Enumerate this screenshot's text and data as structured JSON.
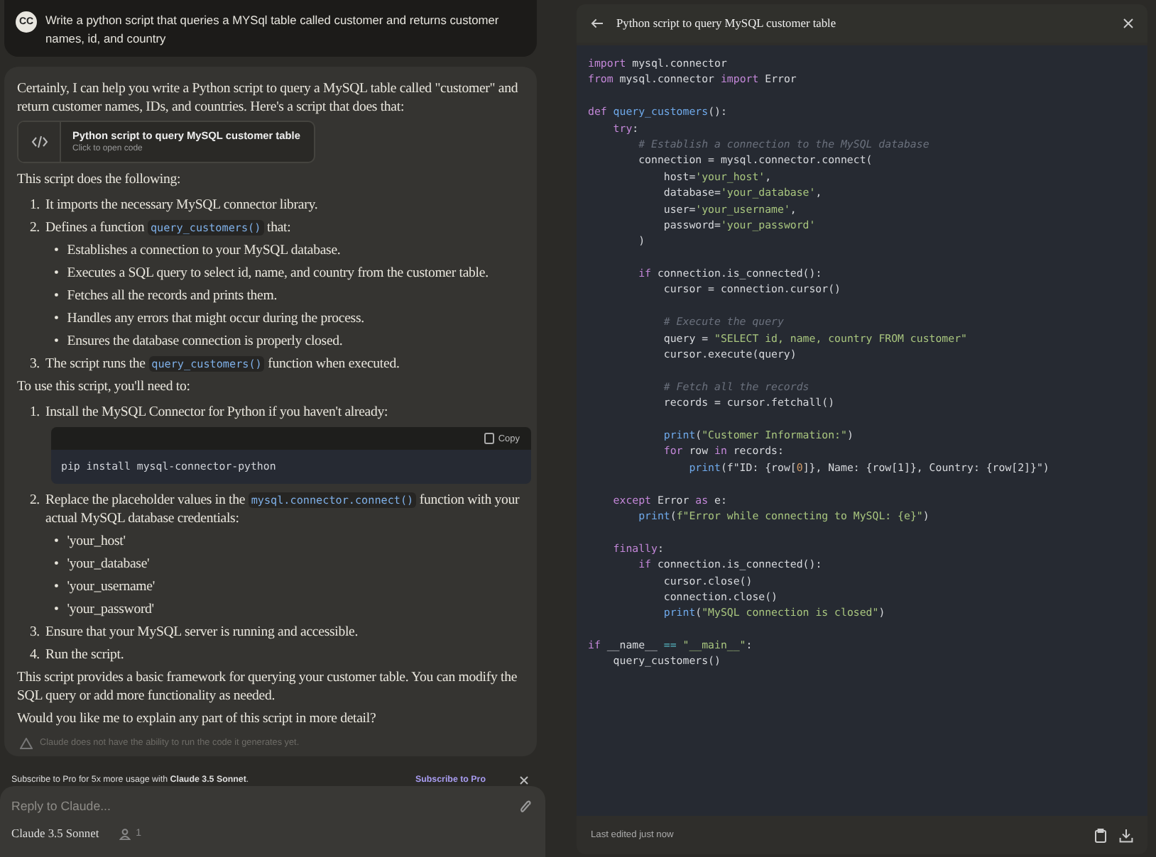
{
  "user_message": {
    "avatar": "CC",
    "text": "Write a python script that queries a MYSql table called customer and returns customer names, id, and country"
  },
  "response": {
    "intro": "Certainly, I can help you write a Python script to query a MySQL table called \"customer\" and return customer names, IDs, and countries. Here's a script that does that:",
    "artifact": {
      "title": "Python script to query MySQL customer table",
      "subtitle": "Click to open code"
    },
    "lead_1": "This script does the following:",
    "list_1": [
      {
        "number": "1.",
        "segments": [
          {
            "kind": "text",
            "text": "It imports the necessary MySQL connector library."
          }
        ]
      },
      {
        "number": "2.",
        "segments": [
          {
            "kind": "text",
            "text": "Defines a function "
          },
          {
            "kind": "code",
            "text": "query_customers()"
          },
          {
            "kind": "text",
            "text": " that:"
          }
        ],
        "children": [
          {
            "marker": "•",
            "text": "Establishes a connection to your MySQL database."
          },
          {
            "marker": "•",
            "text": "Executes a SQL query to select id, name, and country from the customer table."
          },
          {
            "marker": "•",
            "text": "Fetches all the records and prints them."
          },
          {
            "marker": "•",
            "text": "Handles any errors that might occur during the process."
          },
          {
            "marker": "•",
            "text": "Ensures the database connection is properly closed."
          }
        ]
      },
      {
        "number": "3.",
        "segments": [
          {
            "kind": "text",
            "text": "The script runs the "
          },
          {
            "kind": "code",
            "text": "query_customers()"
          },
          {
            "kind": "text",
            "text": " function when executed."
          }
        ]
      }
    ],
    "lead_2": "To use this script, you'll need to:",
    "list_2": [
      {
        "number": "1.",
        "segments": [
          {
            "kind": "text",
            "text": "Install the MySQL Connector for Python if you haven't already:"
          }
        ],
        "code_block": {
          "copy_label": "Copy",
          "code": "pip install mysql-connector-python"
        }
      },
      {
        "number": "2.",
        "segments": [
          {
            "kind": "text",
            "text": "Replace the placeholder values in the "
          },
          {
            "kind": "code",
            "text": "mysql.connector.connect()"
          },
          {
            "kind": "text",
            "text": " function with your actual MySQL database credentials:"
          }
        ],
        "children": [
          {
            "marker": "•",
            "text": "'your_host'"
          },
          {
            "marker": "•",
            "text": "'your_database'"
          },
          {
            "marker": "•",
            "text": "'your_username'"
          },
          {
            "marker": "•",
            "text": "'your_password'"
          }
        ]
      },
      {
        "number": "3.",
        "segments": [
          {
            "kind": "text",
            "text": "Ensure that your MySQL server is running and accessible."
          }
        ]
      },
      {
        "number": "4.",
        "segments": [
          {
            "kind": "text",
            "text": "Run the script."
          }
        ]
      }
    ],
    "closing": "This script provides a basic framework for querying your customer table. You can modify the SQL query or add more functionality as needed.",
    "question": "Would you like me to explain any part of this script in more detail?",
    "disclaimer": "Claude does not have the ability to run the code it generates yet."
  },
  "upgrade_banner": {
    "text": "Subscribe to Pro for 5x more usage with **Claude 3.5 Sonnet**.",
    "link": "Subscribe to Pro"
  },
  "composer": {
    "placeholder": "Reply to Claude...",
    "model": "Claude 3.5 Sonnet",
    "count": "1"
  },
  "code_panel": {
    "title": "Python script to query MySQL customer table",
    "footer": "Last edited just now",
    "lines": [
      {
        "tokens": [
          {
            "kind": "kw",
            "text": "import"
          },
          {
            "kind": "p",
            "text": " mysql.connector"
          }
        ]
      },
      {
        "tokens": [
          {
            "kind": "kw",
            "text": "from"
          },
          {
            "kind": "p",
            "text": " mysql.connector "
          },
          {
            "kind": "kw",
            "text": "import"
          },
          {
            "kind": "p",
            "text": " Error"
          }
        ]
      },
      {
        "gap_before": true,
        "tokens": [
          {
            "kind": "kw",
            "text": "def"
          },
          {
            "kind": "fn",
            "text": " query_customers"
          },
          {
            "kind": "p",
            "text": "():"
          }
        ]
      },
      {
        "tokens": [
          {
            "kind": "kw",
            "text": "    try"
          },
          {
            "kind": "p",
            "text": ":"
          }
        ]
      },
      {
        "tokens": [
          {
            "kind": "cm",
            "text": "        # Establish a connection to the MySQL database"
          }
        ]
      },
      {
        "tokens": [
          {
            "kind": "p",
            "text": "        connection = mysql.connector.connect("
          }
        ]
      },
      {
        "tokens": [
          {
            "kind": "p",
            "text": "            host="
          },
          {
            "kind": "str",
            "text": "'your_host'"
          },
          {
            "kind": "p",
            "text": ","
          }
        ]
      },
      {
        "tokens": [
          {
            "kind": "p",
            "text": "            database="
          },
          {
            "kind": "str",
            "text": "'your_database'"
          },
          {
            "kind": "p",
            "text": ","
          }
        ]
      },
      {
        "tokens": [
          {
            "kind": "p",
            "text": "            user="
          },
          {
            "kind": "str",
            "text": "'your_username'"
          },
          {
            "kind": "p",
            "text": ","
          }
        ]
      },
      {
        "tokens": [
          {
            "kind": "p",
            "text": "            password="
          },
          {
            "kind": "str",
            "text": "'your_password'"
          }
        ]
      },
      {
        "tokens": [
          {
            "kind": "p",
            "text": "        )"
          }
        ]
      },
      {
        "gap_before": true,
        "tokens": [
          {
            "kind": "kw",
            "text": "        if"
          },
          {
            "kind": "p",
            "text": " connection.is_connected():"
          }
        ]
      },
      {
        "tokens": [
          {
            "kind": "p",
            "text": "            cursor = connection.cursor()"
          }
        ]
      },
      {
        "gap_before": true,
        "tokens": [
          {
            "kind": "cm",
            "text": "            # Execute the query"
          }
        ]
      },
      {
        "tokens": [
          {
            "kind": "p",
            "text": "            query = "
          },
          {
            "kind": "str",
            "text": "\"SELECT id, name, country FROM customer\""
          }
        ]
      },
      {
        "tokens": [
          {
            "kind": "p",
            "text": "            cursor.execute(query)"
          }
        ]
      },
      {
        "gap_before": true,
        "tokens": [
          {
            "kind": "cm",
            "text": "            # Fetch all the records"
          }
        ]
      },
      {
        "tokens": [
          {
            "kind": "p",
            "text": "            records = cursor.fetchall()"
          }
        ]
      },
      {
        "gap_before": true,
        "tokens": [
          {
            "kind": "fn",
            "text": "            print"
          },
          {
            "kind": "p",
            "text": "("
          },
          {
            "kind": "str",
            "text": "\"Customer Information:\""
          },
          {
            "kind": "p",
            "text": ")"
          }
        ]
      },
      {
        "tokens": [
          {
            "kind": "kw",
            "text": "            for"
          },
          {
            "kind": "p",
            "text": " row "
          },
          {
            "kind": "kw",
            "text": "in"
          },
          {
            "kind": "p",
            "text": " records:"
          }
        ]
      },
      {
        "tokens": [
          {
            "kind": "fn",
            "text": "                print"
          },
          {
            "kind": "p",
            "text": "(f\"ID: {row["
          },
          {
            "kind": "num",
            "text": "0"
          },
          {
            "kind": "p",
            "text": "]}, Name: {row[1]}, Country: {row[2]}\")"
          }
        ]
      },
      {
        "gap_before": true,
        "tokens": [
          {
            "kind": "kw",
            "text": "    except"
          },
          {
            "kind": "p",
            "text": " Error "
          },
          {
            "kind": "kw",
            "text": "as"
          },
          {
            "kind": "p",
            "text": " e:"
          }
        ]
      },
      {
        "tokens": [
          {
            "kind": "fn",
            "text": "        print"
          },
          {
            "kind": "p",
            "text": "("
          },
          {
            "kind": "str",
            "text": "f\"Error while connecting to MySQL: {e}\""
          },
          {
            "kind": "p",
            "text": ")"
          }
        ]
      },
      {
        "gap_before": true,
        "tokens": [
          {
            "kind": "kw",
            "text": "    finally"
          },
          {
            "kind": "p",
            "text": ":"
          }
        ]
      },
      {
        "tokens": [
          {
            "kind": "kw",
            "text": "        if"
          },
          {
            "kind": "p",
            "text": " connection.is_connected():"
          }
        ]
      },
      {
        "tokens": [
          {
            "kind": "p",
            "text": "            cursor.close()"
          }
        ]
      },
      {
        "tokens": [
          {
            "kind": "p",
            "text": "            connection.close()"
          }
        ]
      },
      {
        "tokens": [
          {
            "kind": "fn",
            "text": "            print"
          },
          {
            "kind": "p",
            "text": "("
          },
          {
            "kind": "str",
            "text": "\"MySQL connection is closed\""
          },
          {
            "kind": "p",
            "text": ")"
          }
        ]
      },
      {
        "gap_before": true,
        "tokens": [
          {
            "kind": "kw",
            "text": "if"
          },
          {
            "kind": "p",
            "text": " __name__ "
          },
          {
            "kind": "op",
            "text": "=="
          },
          {
            "kind": "str",
            "text": " \"__main__\""
          },
          {
            "kind": "p",
            "text": ":"
          }
        ]
      },
      {
        "tokens": [
          {
            "kind": "p",
            "text": "    query_customers()"
          }
        ]
      }
    ]
  }
}
